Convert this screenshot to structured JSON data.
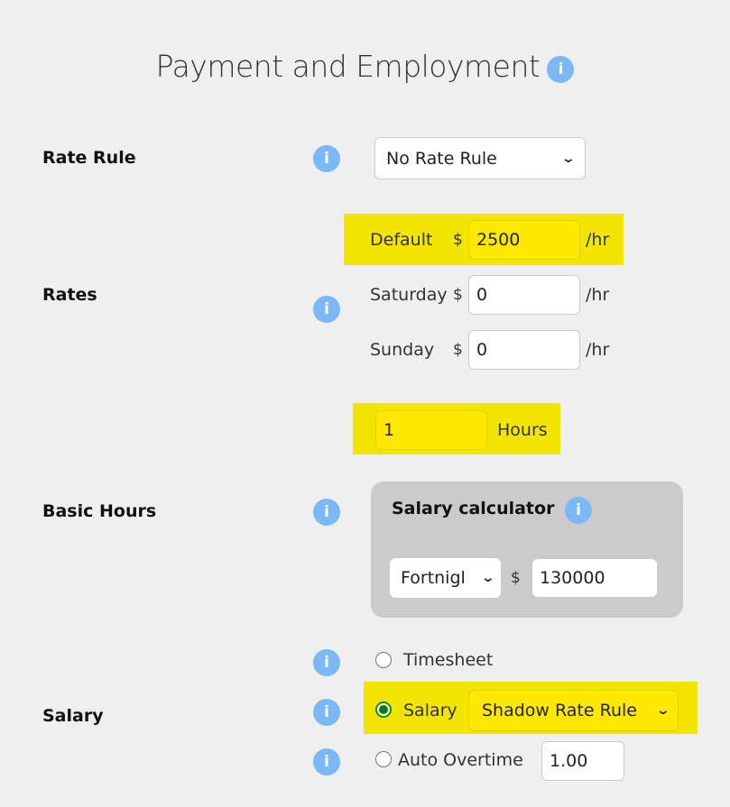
{
  "header": {
    "title": "Payment and Employment",
    "info_icon": "i"
  },
  "rate_rule": {
    "label": "Rate Rule",
    "info_icon": "i",
    "selected": "No Rate Rule"
  },
  "rates": {
    "label": "Rates",
    "info_icon": "i",
    "currency": "$",
    "unit": "/hr",
    "rows": [
      {
        "name": "Default",
        "value": "2500",
        "highlighted": true
      },
      {
        "name": "Saturday",
        "value": "0",
        "highlighted": false
      },
      {
        "name": "Sunday",
        "value": "0",
        "highlighted": false
      }
    ]
  },
  "basic_hours": {
    "label": "Basic Hours",
    "info_icon": "i",
    "hours_value": "1",
    "hours_unit": "Hours",
    "salary_calculator": {
      "title": "Salary calculator",
      "info_icon": "i",
      "period_selected": "Fortnigl",
      "currency": "$",
      "amount": "130000"
    }
  },
  "salary": {
    "label": "Salary",
    "options": [
      {
        "label": "Timesheet",
        "checked": false,
        "info_icon": "i"
      },
      {
        "label": "Salary",
        "checked": true,
        "info_icon": "i",
        "rule_selected": "Shadow Rate Rule"
      },
      {
        "label": "Auto Overtime",
        "checked": false,
        "info_icon": "i",
        "multiplier": "1.00"
      }
    ]
  },
  "colors": {
    "highlight": "#f2e600",
    "info": "#7bb8f7",
    "radio_selected": "#0d7a0d"
  }
}
